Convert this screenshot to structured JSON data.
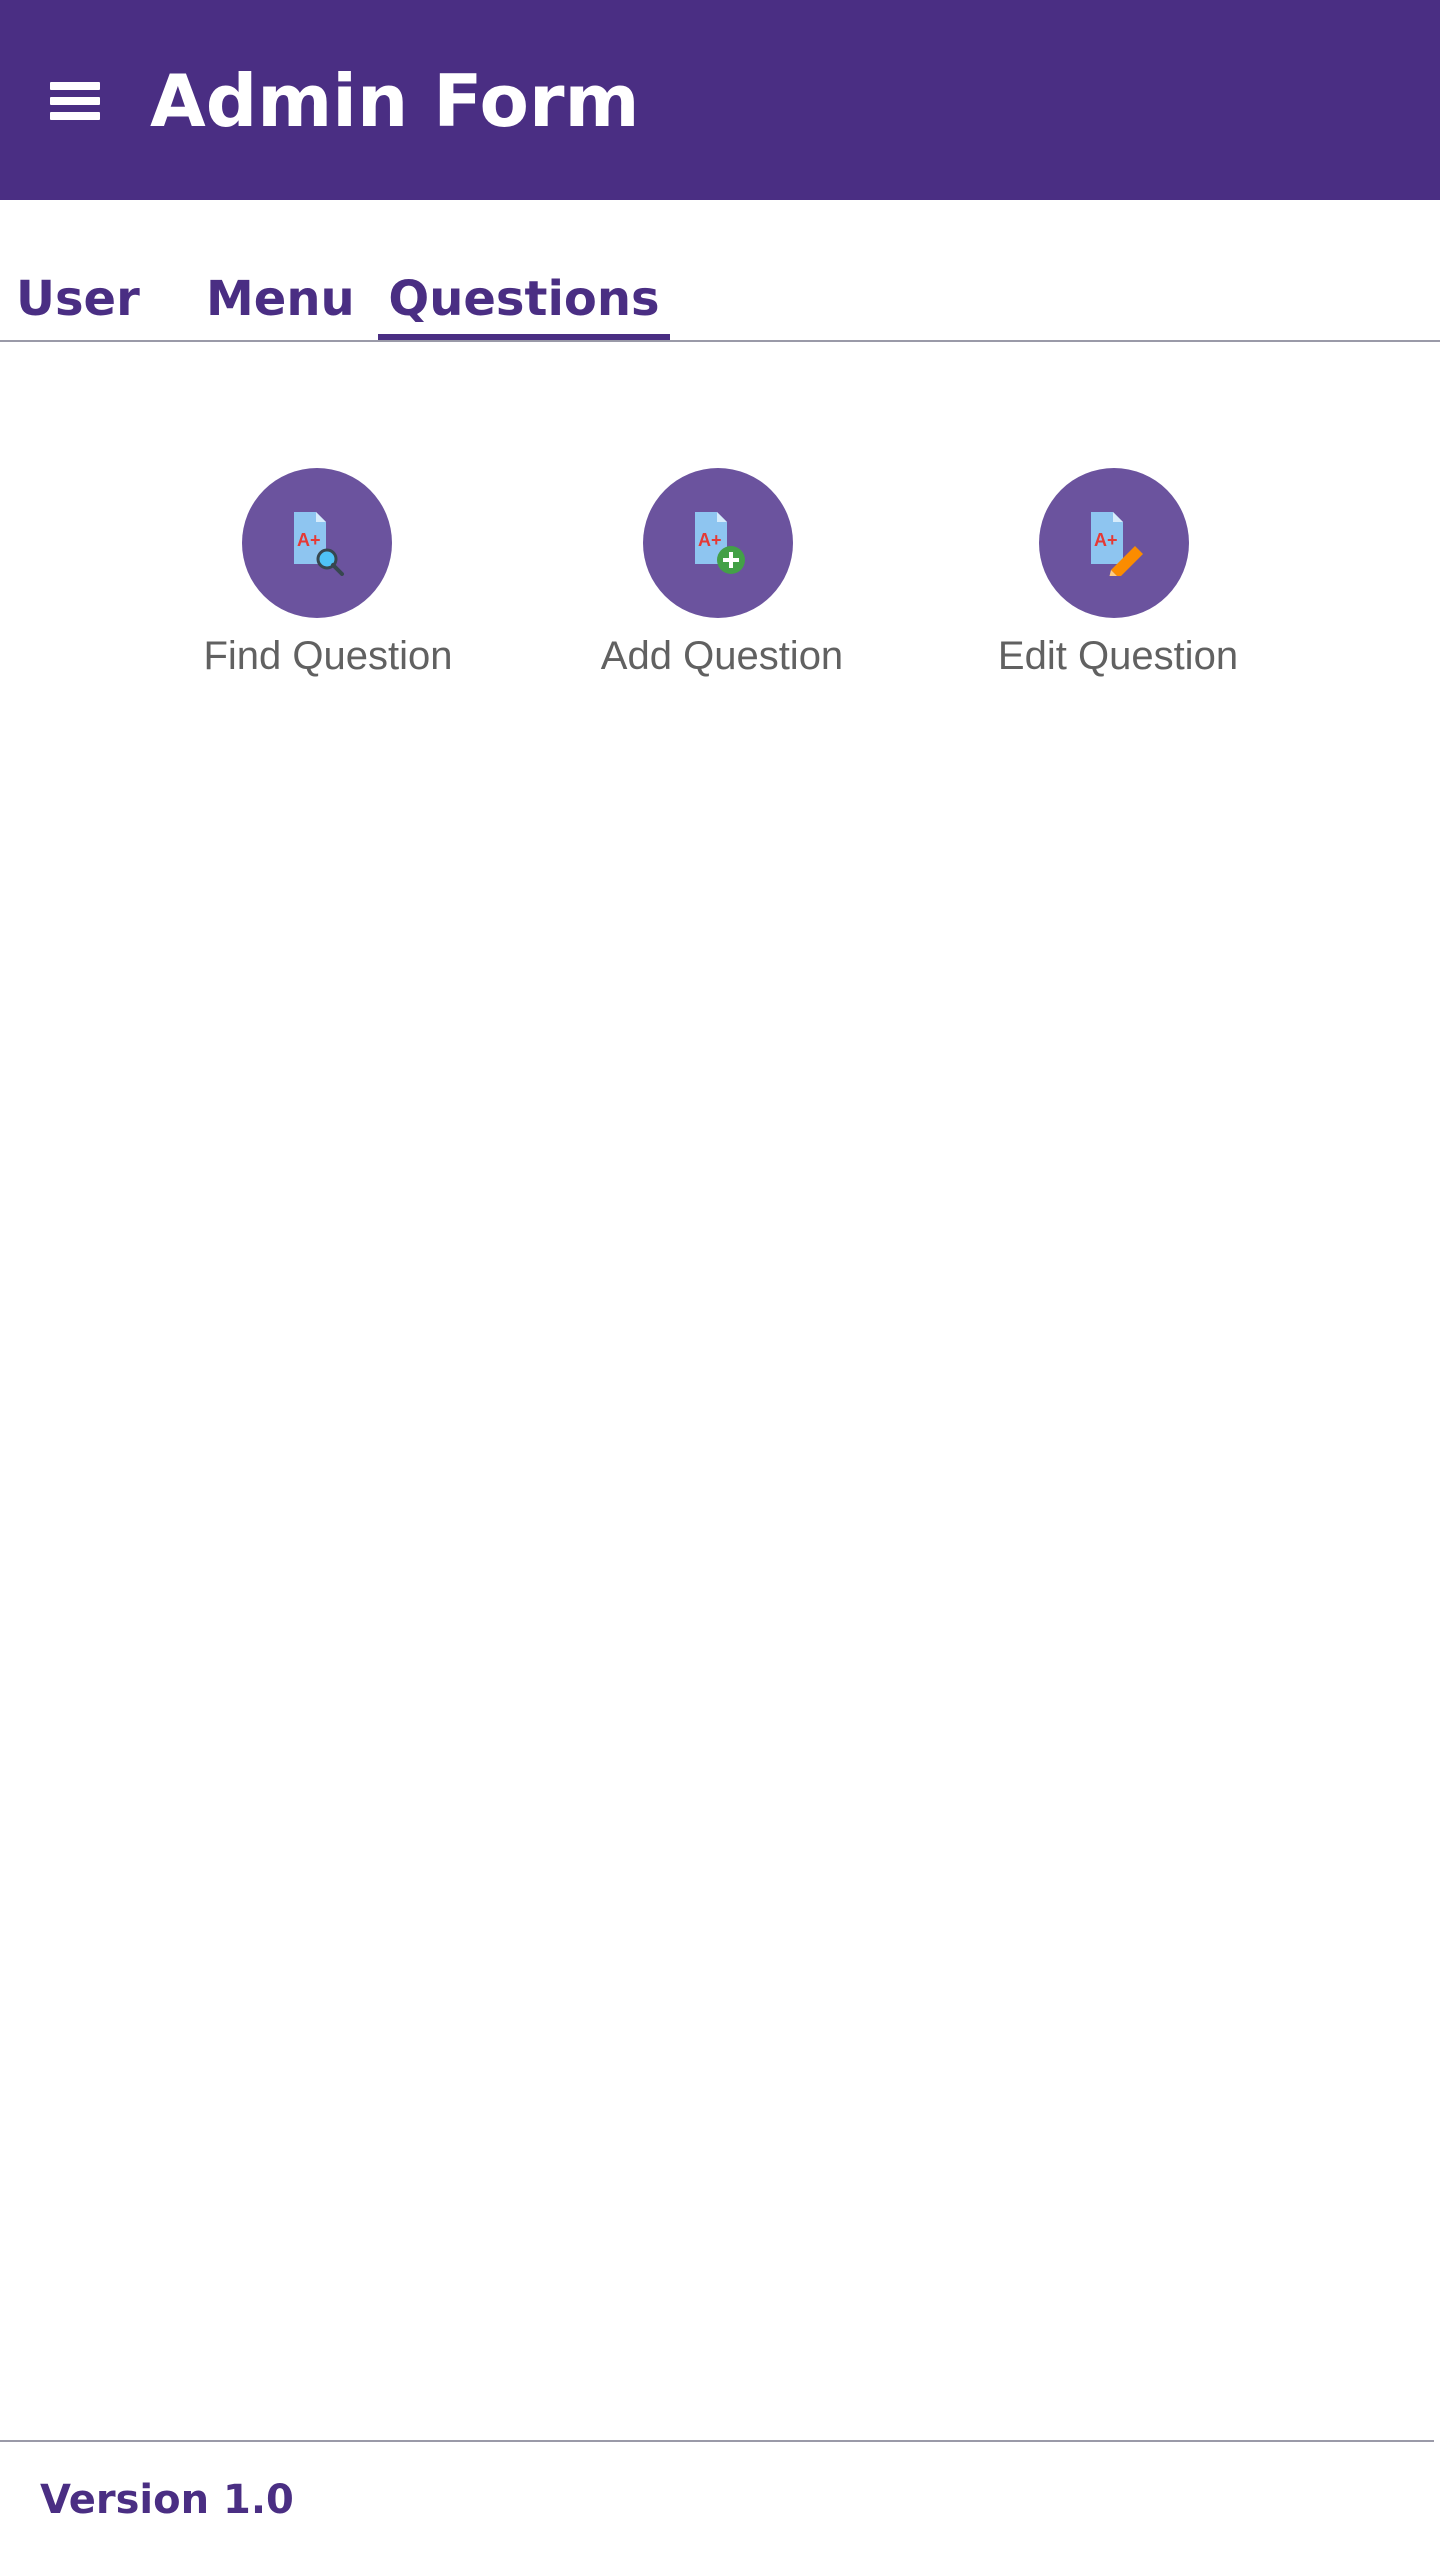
{
  "appbar": {
    "title": "Admin Form",
    "menu_icon": "hamburger-menu-icon",
    "background_color": "#4a2e83"
  },
  "tabs": {
    "items": [
      {
        "label": "User"
      },
      {
        "label": "Menu"
      },
      {
        "label": "Questions"
      }
    ],
    "selected": "Questions",
    "accent_color": "#4a2e83"
  },
  "actions": [
    {
      "label": "Find Question",
      "icon": "document-search-icon"
    },
    {
      "label": "Add Question",
      "icon": "document-add-icon"
    },
    {
      "label": "Edit Question",
      "icon": "document-edit-icon"
    }
  ],
  "action_circle_color": "#6b539e",
  "footer": {
    "version": "Version 1.0"
  }
}
